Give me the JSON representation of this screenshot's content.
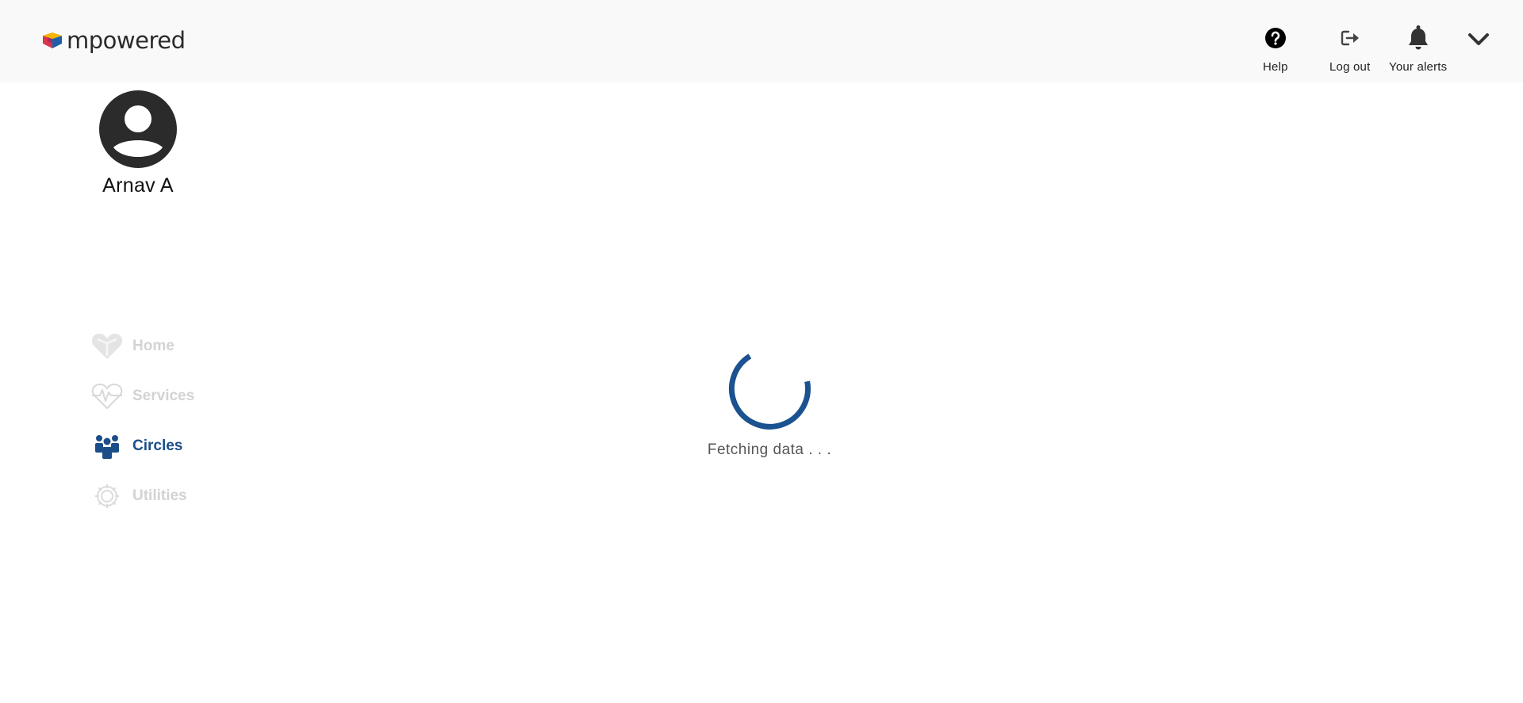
{
  "brand": {
    "name": "mpowered"
  },
  "header": {
    "actions": [
      {
        "id": "help",
        "label": "Help",
        "icon": "help-circle-icon"
      },
      {
        "id": "logout",
        "label": "Log out",
        "icon": "logout-icon"
      },
      {
        "id": "alerts",
        "label": "Your alerts",
        "icon": "bell-icon"
      }
    ],
    "menu_icon": "chevron-down-icon"
  },
  "profile": {
    "name": "Arnav A",
    "avatar_icon": "user-avatar-icon"
  },
  "sidebar": {
    "items": [
      {
        "label": "Home",
        "icon": "heart-icon",
        "active": false
      },
      {
        "label": "Services",
        "icon": "heartbeat-icon",
        "active": false
      },
      {
        "label": "Circles",
        "icon": "people-group-icon",
        "active": true
      },
      {
        "label": "Utilities",
        "icon": "gear-icon",
        "active": false
      }
    ]
  },
  "main": {
    "loading_text": "Fetching data . . ."
  },
  "colors": {
    "accent": "#1b4e88",
    "spinner": "#1b5290",
    "inactive_nav": "#d3d3d3",
    "header_bg": "#f9f9f9"
  }
}
